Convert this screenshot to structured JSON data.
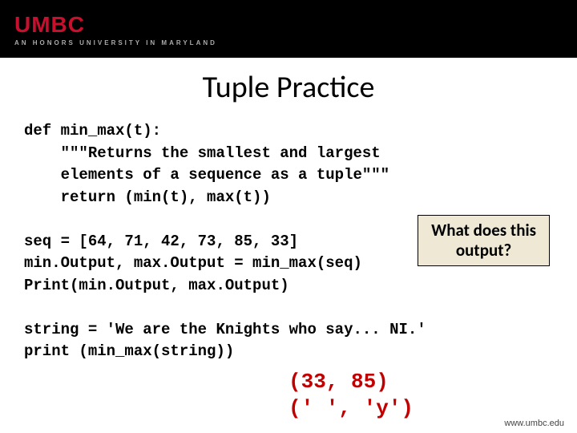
{
  "header": {
    "logo_red": "UMBC",
    "logo_sub": "AN HONORS UNIVERSITY IN MARYLAND"
  },
  "title": "Tuple Practice",
  "code_block": "def min_max(t):\n    \"\"\"Returns the smallest and largest\n    elements of a sequence as a tuple\"\"\"\n    return (min(t), max(t))\n\nseq = [64, 71, 42, 73, 85, 33]\nmin.Output, max.Output = min_max(seq)\nPrint(min.Output, max.Output)\n\nstring = 'We are the Knights who say... NI.'\nprint (min_max(string))",
  "callout": {
    "line1": "What does this",
    "line2": "output?"
  },
  "answer": {
    "line1": "(33, 85)",
    "line2": "(' ', 'y')"
  },
  "footer": "www.umbc.edu"
}
